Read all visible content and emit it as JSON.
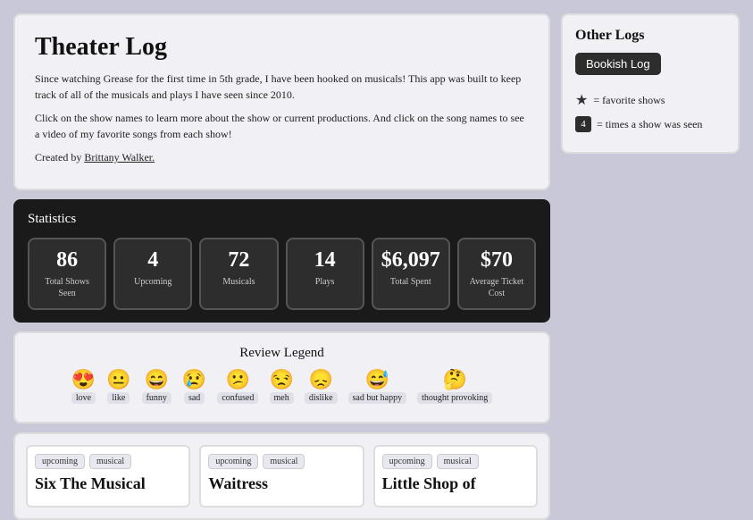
{
  "header": {
    "title": "Theater Log",
    "description1": "Since watching Grease for the first time in 5th grade, I have been hooked on musicals! This app was built to keep track of all of the musicals and plays I have seen since 2010.",
    "description2": "Click on the show names to learn more about the show or current productions. And click on the song names to see a video of my favorite songs from each show!",
    "created_by_label": "Created by",
    "author": "Brittany Walker."
  },
  "statistics": {
    "section_title": "Statistics",
    "stats": [
      {
        "number": "86",
        "label": "Total Shows Seen"
      },
      {
        "number": "4",
        "label": "Upcoming"
      },
      {
        "number": "72",
        "label": "Musicals"
      },
      {
        "number": "14",
        "label": "Plays"
      },
      {
        "number": "$6,097",
        "label": "Total Spent"
      },
      {
        "number": "$70",
        "label": "Average Ticket Cost"
      }
    ]
  },
  "review_legend": {
    "title": "Review Legend",
    "items": [
      {
        "emoji": "😍",
        "label": "love"
      },
      {
        "emoji": "😐",
        "label": "like"
      },
      {
        "emoji": "😄",
        "label": "funny"
      },
      {
        "emoji": "😢",
        "label": "sad"
      },
      {
        "emoji": "😕",
        "label": "confused"
      },
      {
        "emoji": "😒",
        "label": "meh"
      },
      {
        "emoji": "😞",
        "label": "dislike"
      },
      {
        "emoji": "😅",
        "label": "sad but happy"
      },
      {
        "emoji": "🤔",
        "label": "thought provoking"
      }
    ]
  },
  "shows": [
    {
      "tags": [
        "upcoming",
        "musical"
      ],
      "name": "Six The Musical"
    },
    {
      "tags": [
        "upcoming",
        "musical"
      ],
      "name": "Waitress"
    },
    {
      "tags": [
        "upcoming",
        "musical"
      ],
      "name": "Little Shop of"
    }
  ],
  "sidebar": {
    "other_logs_title": "Other Logs",
    "bookish_button": "Bookish Log",
    "legend": {
      "star_label": "= favorite shows",
      "number": "4",
      "number_label": "= times a show was seen"
    }
  }
}
